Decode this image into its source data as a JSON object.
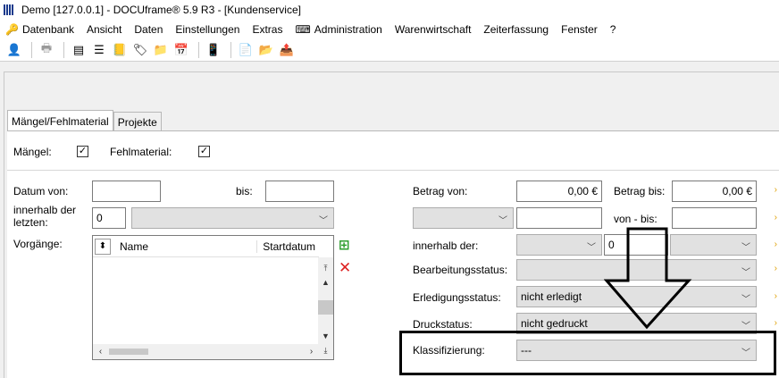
{
  "window": {
    "title": "Demo [127.0.0.1] - DOCUframe® 5.9 R3 - [Kundenservice]"
  },
  "menu": {
    "items": [
      "Datenbank",
      "Ansicht",
      "Daten",
      "Einstellungen",
      "Extras",
      "Administration",
      "Warenwirtschaft",
      "Zeiterfassung",
      "Fenster",
      "?"
    ]
  },
  "tabs": [
    "Mängel/Fehlmaterial",
    "Projekte"
  ],
  "filters": {
    "maengel_label": "Mängel:",
    "fehlmaterial_label": "Fehlmaterial:",
    "maengel_checked": "✓",
    "fehlmaterial_checked": "✓"
  },
  "left": {
    "datum_von_label": "Datum von:",
    "bis_label": "bis:",
    "innerhalb_label_1": "innerhalb der",
    "innerhalb_label_2": "letzten:",
    "innerhalb_value": "0",
    "vorgaenge_label": "Vorgänge:",
    "col_name": "Name",
    "col_startdatum": "Startdatum"
  },
  "right": {
    "betrag_von_label": "Betrag von:",
    "betrag_von_value": "0,00 €",
    "betrag_bis_label": "Betrag bis:",
    "betrag_bis_value": "0,00 €",
    "von_bis_label": "von - bis:",
    "innerhalb_der_label": "innerhalb der:",
    "innerhalb_der_value": "0",
    "bearbeitungsstatus_label": "Bearbeitungsstatus:",
    "erledigungsstatus_label": "Erledigungsstatus:",
    "erledigungsstatus_value": "nicht erledigt",
    "druckstatus_label": "Druckstatus:",
    "druckstatus_value": "nicht gedruckt",
    "klassifizierung_label": "Klassifizierung:",
    "klassifizierung_value": "---"
  },
  "icons": {
    "add": "add-green-icon",
    "delete": "delete-red-icon",
    "highlight_color": "#000000"
  }
}
